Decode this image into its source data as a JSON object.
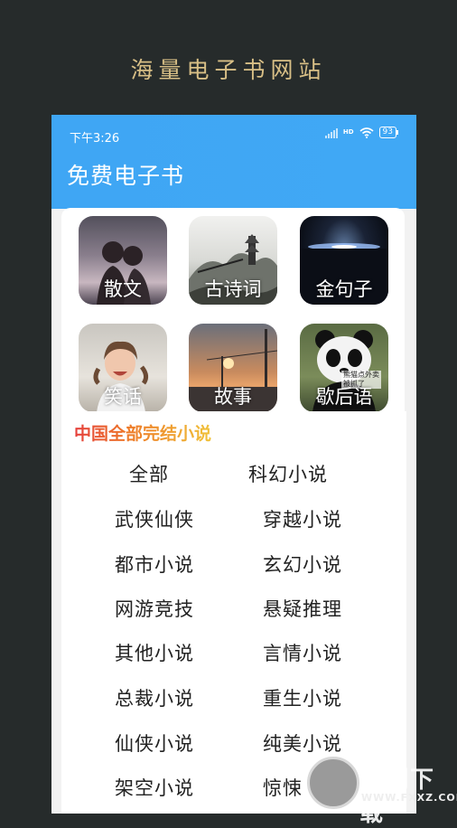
{
  "promo": {
    "title": "海量电子书网站"
  },
  "status_bar": {
    "time": "下午3:26",
    "network": "HD",
    "battery": "93"
  },
  "app": {
    "title": "免费电子书"
  },
  "categories_grid": [
    {
      "label": "散文",
      "icon": "couple-photo"
    },
    {
      "label": "古诗词",
      "icon": "landscape-painting"
    },
    {
      "label": "金句子",
      "icon": "planet-horizon"
    },
    {
      "label": "笑话",
      "icon": "laughing-girl"
    },
    {
      "label": "故事",
      "icon": "sunset-street"
    },
    {
      "label": "歇后语",
      "icon": "panda-photo"
    }
  ],
  "panda_caption": [
    "熊猫点外卖",
    "被抓了"
  ],
  "section": {
    "title": "中国全部完结小说"
  },
  "novel_categories": [
    [
      "全部",
      "科幻小说"
    ],
    [
      "武侠仙侠",
      "穿越小说"
    ],
    [
      "都市小说",
      "玄幻小说"
    ],
    [
      "网游竞技",
      "悬疑推理"
    ],
    [
      "其他小说",
      "言情小说"
    ],
    [
      "总裁小说",
      "重生小说"
    ],
    [
      "仙侠小说",
      "纯美小说"
    ],
    [
      "架空小说",
      "惊悚"
    ]
  ],
  "watermark": {
    "text": "飞翔下载",
    "url": "WWW.FXXZ.COM"
  },
  "colors": {
    "header": "#3fa6f4",
    "background": "#262b2b",
    "promo": "#d8bf86"
  }
}
